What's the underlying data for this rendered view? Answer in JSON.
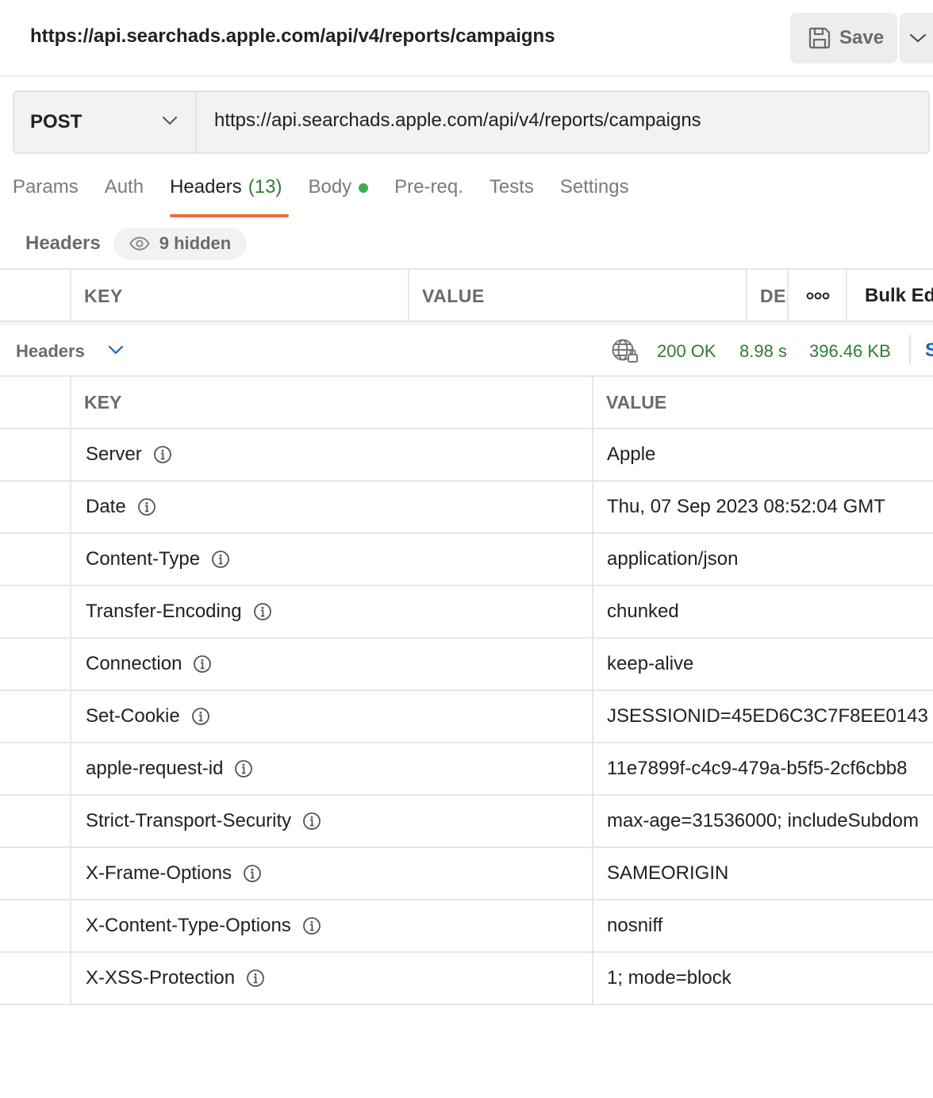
{
  "titlebar": {
    "title": "https://api.searchads.apple.com/api/v4/reports/campaigns",
    "save_label": "Save",
    "save_icon": "floppy-disk-icon",
    "more_icon": "chevron-down-icon"
  },
  "request": {
    "method": "POST",
    "url": "https://api.searchads.apple.com/api/v4/reports/campaigns"
  },
  "tabs": {
    "params": "Params",
    "auth": "Auth",
    "headers": "Headers",
    "headers_count": "(13)",
    "body": "Body",
    "prereq": "Pre-req.",
    "tests": "Tests",
    "settings": "Settings",
    "active": "Headers"
  },
  "request_headers": {
    "title": "Headers",
    "hidden_label": "9 hidden",
    "col_key": "KEY",
    "col_value": "VALUE",
    "col_desc": "DES",
    "bulk_edit": "Bulk Ed"
  },
  "response": {
    "title": "Headers",
    "status": "200 OK",
    "time": "8.98 s",
    "size": "396.46 KB",
    "save_partial": "S",
    "col_key": "KEY",
    "col_value": "VALUE",
    "rows": [
      {
        "key": "Server",
        "value": "Apple"
      },
      {
        "key": "Date",
        "value": "Thu, 07 Sep 2023 08:52:04 GMT"
      },
      {
        "key": "Content-Type",
        "value": "application/json"
      },
      {
        "key": "Transfer-Encoding",
        "value": "chunked"
      },
      {
        "key": "Connection",
        "value": "keep-alive"
      },
      {
        "key": "Set-Cookie",
        "value": "JSESSIONID=45ED6C3C7F8EE0143"
      },
      {
        "key": "apple-request-id",
        "value": "11e7899f-c4c9-479a-b5f5-2cf6cbb8"
      },
      {
        "key": "Strict-Transport-Security",
        "value": "max-age=31536000; includeSubdom"
      },
      {
        "key": "X-Frame-Options",
        "value": "SAMEORIGIN"
      },
      {
        "key": "X-Content-Type-Options",
        "value": "nosniff"
      },
      {
        "key": "X-XSS-Protection",
        "value": "1; mode=block"
      }
    ]
  },
  "colors": {
    "accent": "#ef6c3b",
    "success": "#2e7d32",
    "body_dot": "#3fae4e",
    "link": "#1565c0"
  }
}
